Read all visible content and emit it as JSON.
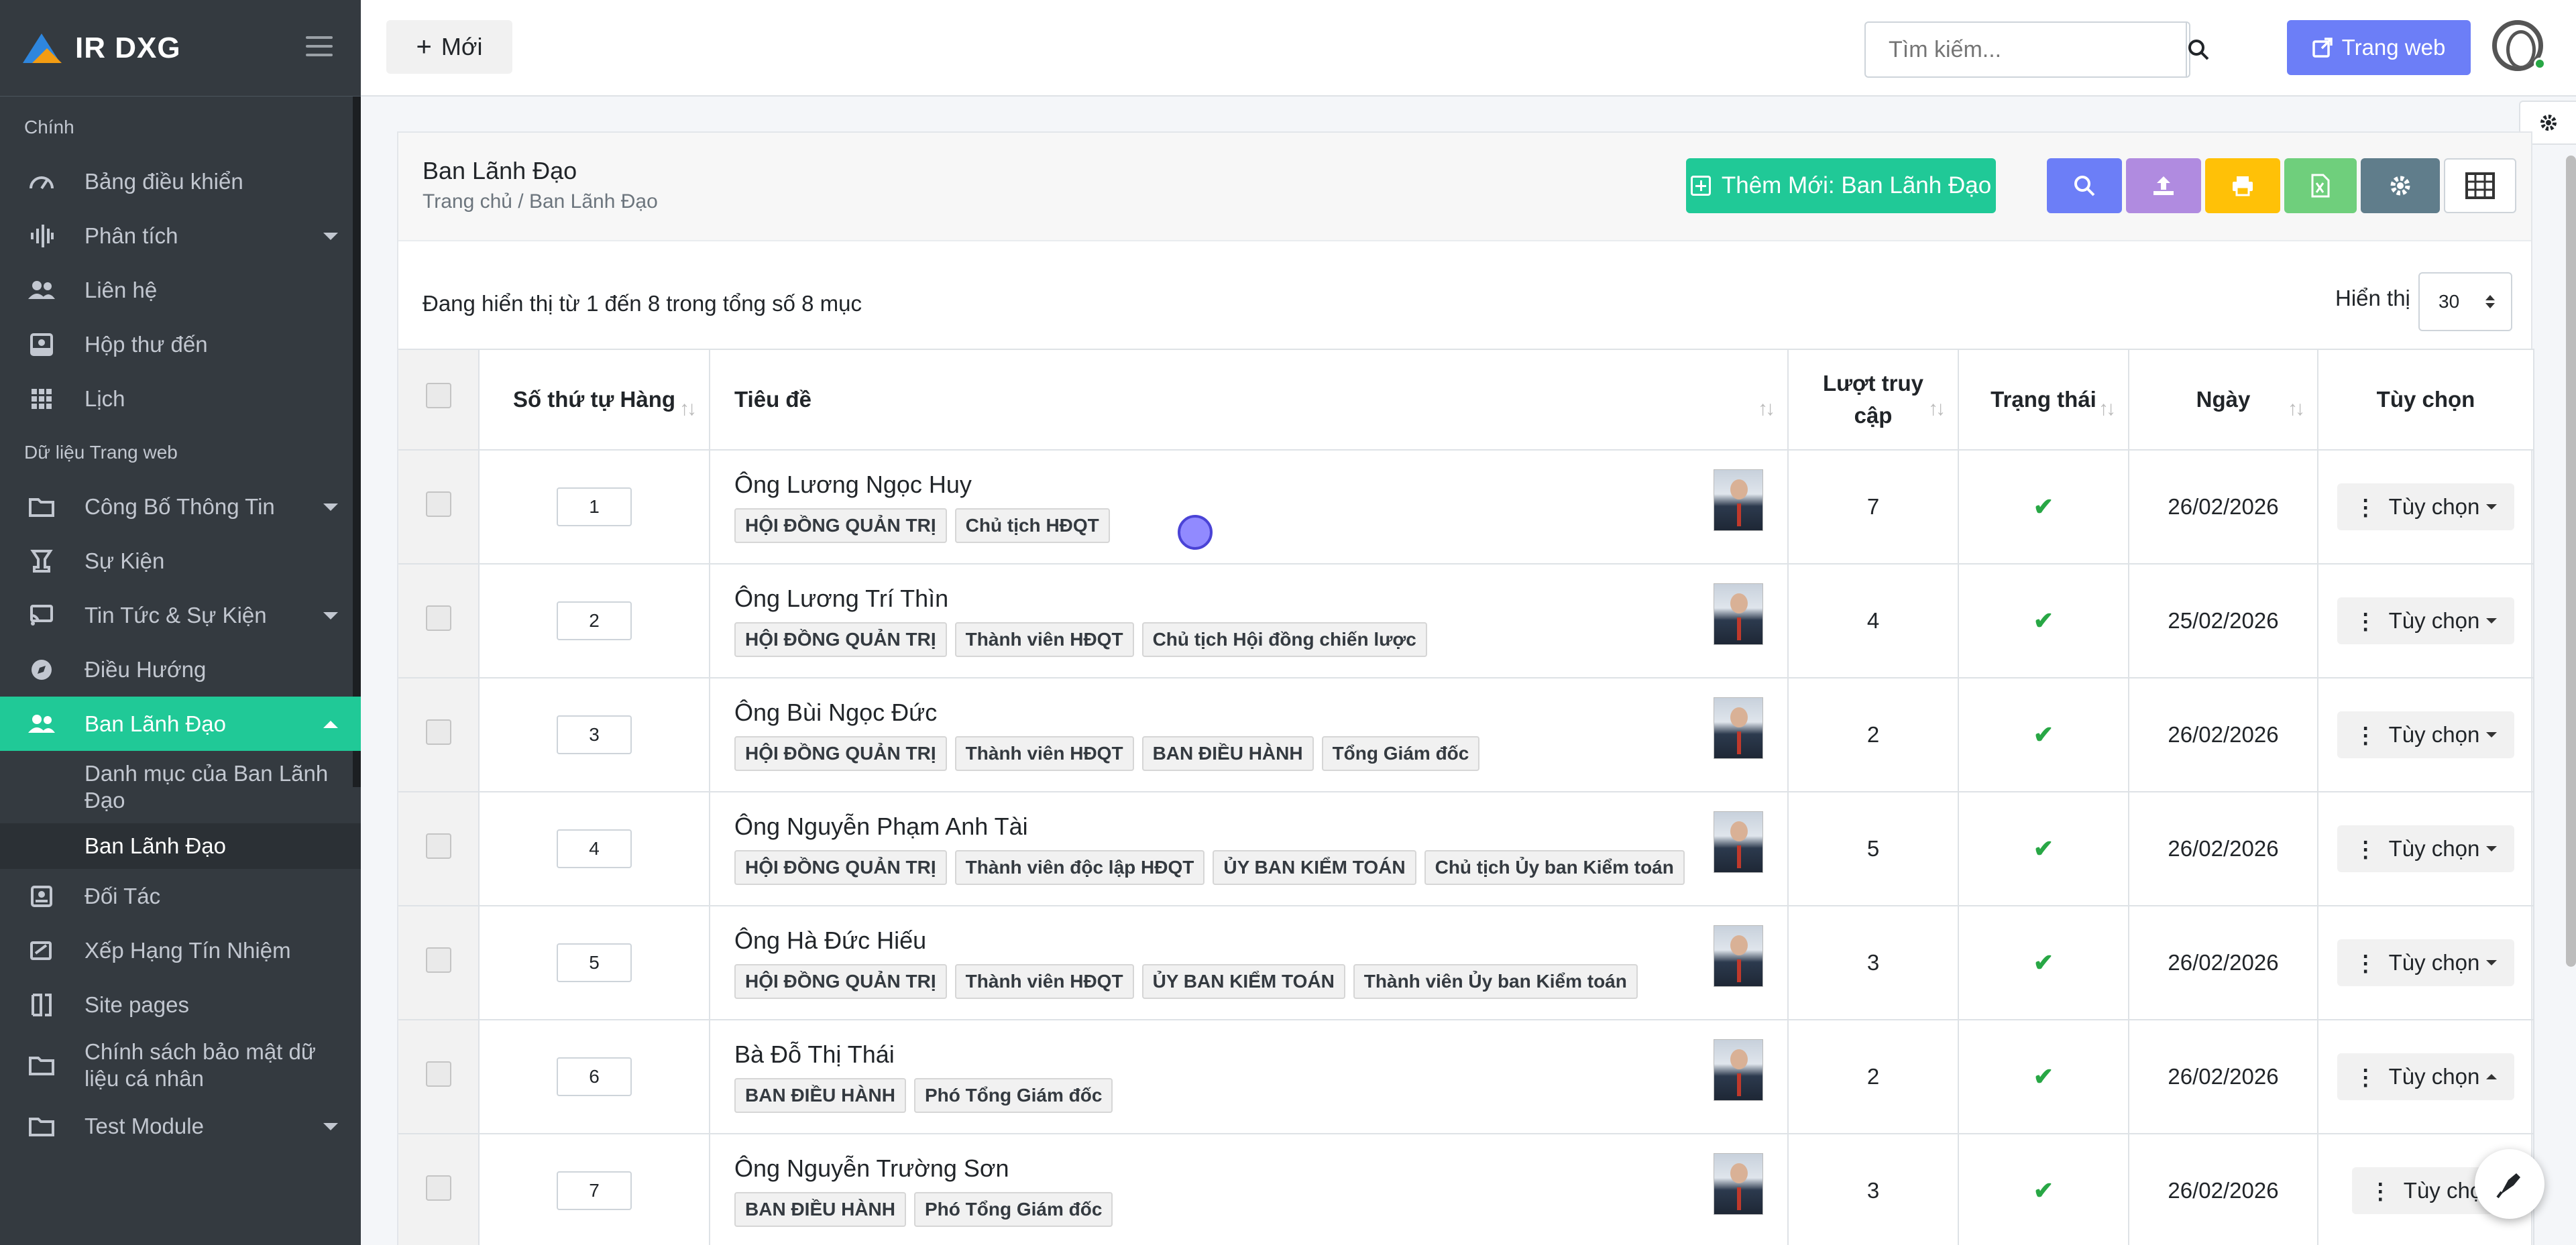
{
  "brand": {
    "name": "IR DXG"
  },
  "sidebar": {
    "section_main": "Chính",
    "main_items": [
      {
        "label": "Bảng điều khiển",
        "icon": "gauge-icon"
      },
      {
        "label": "Phân tích",
        "icon": "waveform-icon"
      },
      {
        "label": "Liên hệ",
        "icon": "users-icon"
      },
      {
        "label": "Hộp thư đến",
        "icon": "inbox-icon"
      },
      {
        "label": "Lịch",
        "icon": "grid-icon"
      }
    ],
    "section_data": "Dữ liệu Trang web",
    "data_items": [
      {
        "label": "Công Bố Thông Tin",
        "icon": "folder-icon"
      },
      {
        "label": "Sự Kiện",
        "icon": "trophy-icon"
      },
      {
        "label": "Tin Tức & Sự Kiện",
        "icon": "rss-icon"
      },
      {
        "label": "Điều Hướng",
        "icon": "compass-icon"
      },
      {
        "label": "Ban Lãnh Đạo",
        "icon": "user-group-icon"
      }
    ],
    "sub_items": [
      {
        "label": "Danh mục của Ban Lãnh Đạo"
      },
      {
        "label": "Ban Lãnh Đạo"
      }
    ],
    "more_items": [
      {
        "label": "Đối Tác",
        "icon": "id-card-icon"
      },
      {
        "label": "Xếp Hạng Tín Nhiệm",
        "icon": "signature-icon"
      },
      {
        "label": "Site pages",
        "icon": "pages-icon"
      },
      {
        "label": "Chính sách bảo mật dữ liệu cá nhân",
        "icon": "folder-icon"
      },
      {
        "label": "Test Module",
        "icon": "folder-icon"
      }
    ]
  },
  "topbar": {
    "new_label": "Mới",
    "search_placeholder": "Tìm kiếm...",
    "website_label": "Trang web"
  },
  "page": {
    "title": "Ban Lãnh Đạo",
    "breadcrumb": "Trang chủ / Ban Lãnh Đạo",
    "add_label": "Thêm Mới: Ban Lãnh Đạo",
    "summary": "Đang hiển thị từ 1 đến 8 trong tổng số 8 mục",
    "show_label": "Hiển thị",
    "page_size": "30"
  },
  "table": {
    "headers": {
      "order": "Số thứ tự Hàng",
      "title": "Tiêu đề",
      "visits_line1": "Lượt truy",
      "visits_line2": "cập",
      "status": "Trạng thái",
      "date": "Ngày",
      "options": "Tùy chọn"
    },
    "rows": [
      {
        "order": "1",
        "name": "Ông Lương Ngọc Huy",
        "tags": [
          "HỘI ĐỒNG QUẢN TRỊ",
          "Chủ tịch HĐQT"
        ],
        "visits": "7",
        "date": "26/02/2026",
        "option": "Tùy chọn"
      },
      {
        "order": "2",
        "name": "Ông Lương Trí Thìn",
        "tags": [
          "HỘI ĐỒNG QUẢN TRỊ",
          "Thành viên HĐQT",
          "Chủ tịch Hội đồng chiến lược"
        ],
        "visits": "4",
        "date": "25/02/2026",
        "option": "Tùy chọn"
      },
      {
        "order": "3",
        "name": "Ông Bùi Ngọc Đức",
        "tags": [
          "HỘI ĐỒNG QUẢN TRỊ",
          "Thành viên HĐQT",
          "BAN ĐIỀU HÀNH",
          "Tổng Giám đốc"
        ],
        "visits": "2",
        "date": "26/02/2026",
        "option": "Tùy chọn"
      },
      {
        "order": "4",
        "name": "Ông Nguyễn Phạm Anh Tài",
        "tags": [
          "HỘI ĐỒNG QUẢN TRỊ",
          "Thành viên độc lập HĐQT",
          "ỦY BAN KIỂM TOÁN",
          "Chủ tịch Ủy ban Kiểm toán"
        ],
        "visits": "5",
        "date": "26/02/2026",
        "option": "Tùy chọn"
      },
      {
        "order": "5",
        "name": "Ông Hà Đức Hiếu",
        "tags": [
          "HỘI ĐỒNG QUẢN TRỊ",
          "Thành viên HĐQT",
          "ỦY BAN KIỂM TOÁN",
          "Thành viên Ủy ban Kiểm toán"
        ],
        "visits": "3",
        "date": "26/02/2026",
        "option": "Tùy chọn"
      },
      {
        "order": "6",
        "name": "Bà Đỗ Thị Thái",
        "tags": [
          "BAN ĐIỀU HÀNH",
          "Phó Tổng Giám đốc"
        ],
        "visits": "2",
        "date": "26/02/2026",
        "option": "Tùy chọn"
      },
      {
        "order": "7",
        "name": "Ông Nguyễn Trường Sơn",
        "tags": [
          "BAN ĐIỀU HÀNH",
          "Phó Tổng Giám đốc"
        ],
        "visits": "3",
        "date": "26/02/2026",
        "option": "Tùy chọ"
      }
    ]
  },
  "colors": {
    "accent": "#20c997",
    "sidebar": "#343a40",
    "primary": "#6c7ef7",
    "success": "#28a745"
  }
}
